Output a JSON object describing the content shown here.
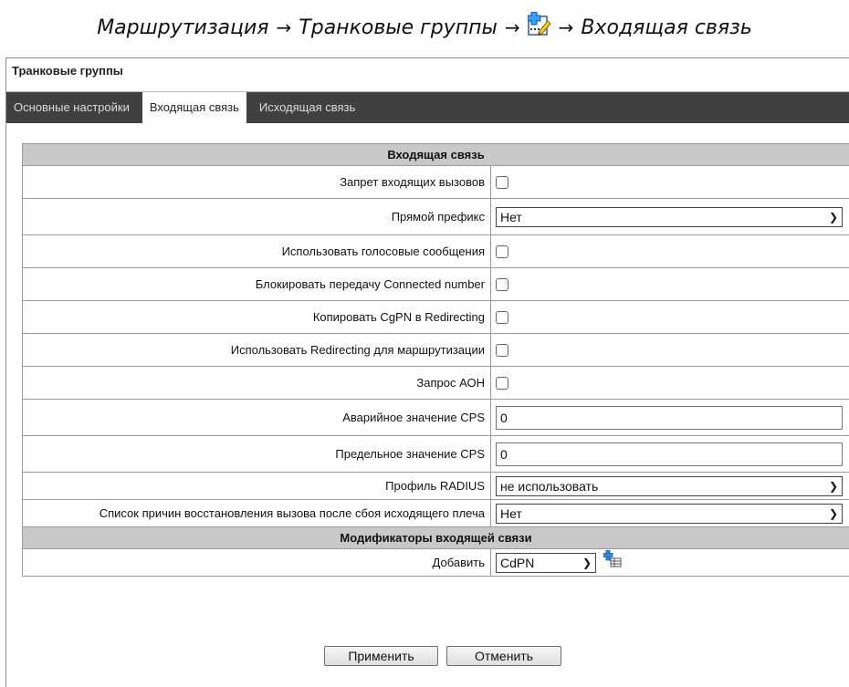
{
  "caption": {
    "part1": "Маршрутизация",
    "arrow": "→",
    "part2": "Транковые группы",
    "part3": "Входящая связь",
    "icon": "edit-icon"
  },
  "window": {
    "title": "Транковые группы",
    "tabs": [
      {
        "label": "Основные настройки",
        "active": false
      },
      {
        "label": "Входящая связь",
        "active": true
      },
      {
        "label": "Исходящая связь",
        "active": false
      }
    ]
  },
  "form": {
    "section1": "Входящая связь",
    "rows": {
      "block_incoming": {
        "label": "Запрет входящих вызовов",
        "checked": false
      },
      "direct_prefix": {
        "label": "Прямой префикс",
        "value": "Нет"
      },
      "voice_messages": {
        "label": "Использовать голосовые сообщения",
        "checked": false
      },
      "block_connected": {
        "label": "Блокировать передачу Connected number",
        "checked": false
      },
      "copy_cgpn": {
        "label": "Копировать CgPN в Redirecting",
        "checked": false
      },
      "use_redirecting": {
        "label": "Использовать Redirecting для маршрутизации",
        "checked": false
      },
      "aon_request": {
        "label": "Запрос АОН",
        "checked": false
      },
      "emergency_cps": {
        "label": "Аварийное значение CPS",
        "value": "0"
      },
      "limit_cps": {
        "label": "Предельное значение CPS",
        "value": "0"
      },
      "radius_profile": {
        "label": "Профиль RADIUS",
        "value": "не использовать"
      },
      "restore_reasons": {
        "label": "Список причин восстановления вызова после сбоя исходящего плеча",
        "value": "Нет"
      }
    },
    "section2": "Модификаторы входящей связи",
    "add_row": {
      "label": "Добавить",
      "value": "CdPN",
      "icon": "add-table-icon"
    }
  },
  "buttons": {
    "apply": "Применить",
    "cancel": "Отменить"
  }
}
